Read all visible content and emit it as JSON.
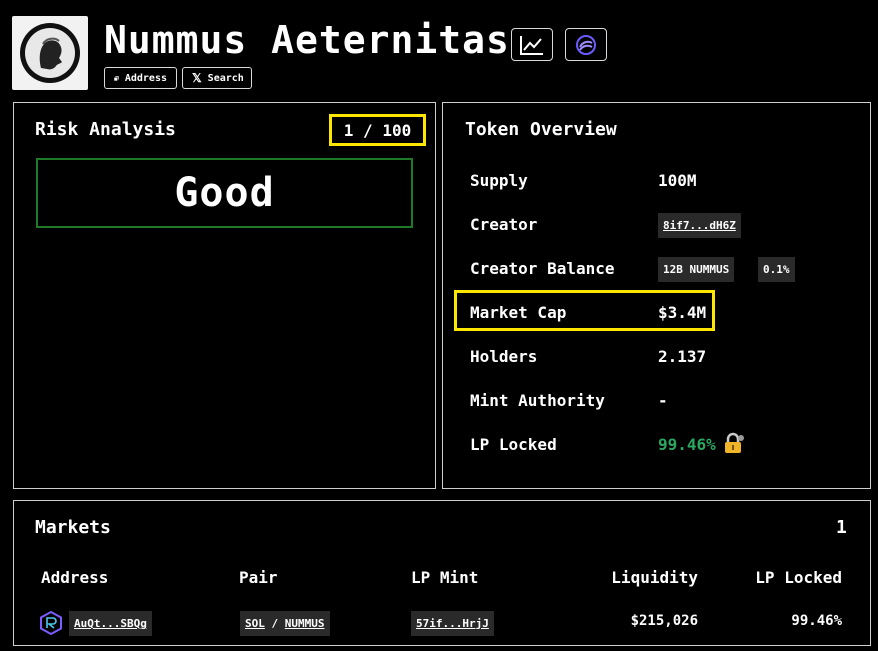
{
  "header": {
    "title": "Nummus Aeternitas",
    "address_label": "Address",
    "search_label": "Search"
  },
  "risk": {
    "title": "Risk Analysis",
    "score": "1 / 100",
    "rating": "Good"
  },
  "overview": {
    "title": "Token Overview",
    "rows": {
      "supply": {
        "label": "Supply",
        "value": "100M"
      },
      "creator": {
        "label": "Creator",
        "value": "8if7...dH6Z"
      },
      "creator_balance": {
        "label": "Creator Balance",
        "amount": "12B NUMMUS",
        "percent": "0.1%"
      },
      "market_cap": {
        "label": "Market Cap",
        "value": "$3.4M"
      },
      "holders": {
        "label": "Holders",
        "value": "2.137"
      },
      "mint_authority": {
        "label": "Mint Authority",
        "value": "-"
      },
      "lp_locked": {
        "label": "LP Locked",
        "value": "99.46%"
      }
    }
  },
  "markets": {
    "title": "Markets",
    "count": "1",
    "columns": [
      "Address",
      "Pair",
      "LP Mint",
      "Liquidity",
      "LP Locked"
    ],
    "rows": [
      {
        "address": "AuQt...SBQg",
        "pair_base": "SOL",
        "pair_sep": "/",
        "pair_quote": "NUMMUS",
        "lp_mint": "57if...HrjJ",
        "liquidity": "$215,026",
        "lp_locked": "99.46%"
      }
    ]
  },
  "colors": {
    "highlight": "#ffe600",
    "good_border": "#1f7a28",
    "lp_green": "#2aa860",
    "lock_gold": "#f0b429",
    "raydium_purple": "#7b5cff"
  }
}
